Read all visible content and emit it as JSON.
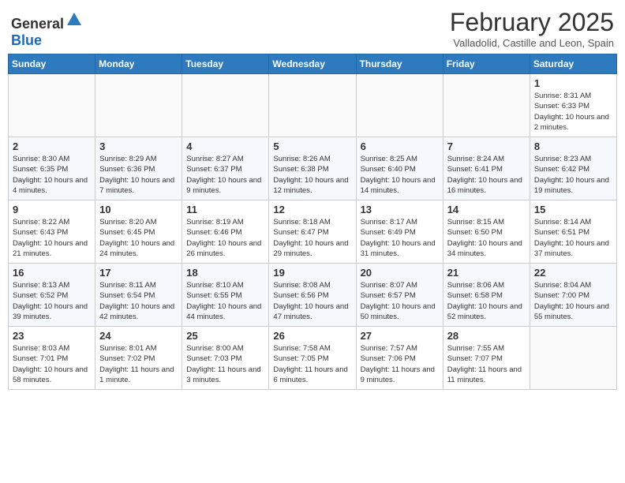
{
  "header": {
    "logo_general": "General",
    "logo_blue": "Blue",
    "month_year": "February 2025",
    "location": "Valladolid, Castille and Leon, Spain"
  },
  "weekdays": [
    "Sunday",
    "Monday",
    "Tuesday",
    "Wednesday",
    "Thursday",
    "Friday",
    "Saturday"
  ],
  "weeks": [
    [
      {
        "day": "",
        "info": ""
      },
      {
        "day": "",
        "info": ""
      },
      {
        "day": "",
        "info": ""
      },
      {
        "day": "",
        "info": ""
      },
      {
        "day": "",
        "info": ""
      },
      {
        "day": "",
        "info": ""
      },
      {
        "day": "1",
        "info": "Sunrise: 8:31 AM\nSunset: 6:33 PM\nDaylight: 10 hours and 2 minutes."
      }
    ],
    [
      {
        "day": "2",
        "info": "Sunrise: 8:30 AM\nSunset: 6:35 PM\nDaylight: 10 hours and 4 minutes."
      },
      {
        "day": "3",
        "info": "Sunrise: 8:29 AM\nSunset: 6:36 PM\nDaylight: 10 hours and 7 minutes."
      },
      {
        "day": "4",
        "info": "Sunrise: 8:27 AM\nSunset: 6:37 PM\nDaylight: 10 hours and 9 minutes."
      },
      {
        "day": "5",
        "info": "Sunrise: 8:26 AM\nSunset: 6:38 PM\nDaylight: 10 hours and 12 minutes."
      },
      {
        "day": "6",
        "info": "Sunrise: 8:25 AM\nSunset: 6:40 PM\nDaylight: 10 hours and 14 minutes."
      },
      {
        "day": "7",
        "info": "Sunrise: 8:24 AM\nSunset: 6:41 PM\nDaylight: 10 hours and 16 minutes."
      },
      {
        "day": "8",
        "info": "Sunrise: 8:23 AM\nSunset: 6:42 PM\nDaylight: 10 hours and 19 minutes."
      }
    ],
    [
      {
        "day": "9",
        "info": "Sunrise: 8:22 AM\nSunset: 6:43 PM\nDaylight: 10 hours and 21 minutes."
      },
      {
        "day": "10",
        "info": "Sunrise: 8:20 AM\nSunset: 6:45 PM\nDaylight: 10 hours and 24 minutes."
      },
      {
        "day": "11",
        "info": "Sunrise: 8:19 AM\nSunset: 6:46 PM\nDaylight: 10 hours and 26 minutes."
      },
      {
        "day": "12",
        "info": "Sunrise: 8:18 AM\nSunset: 6:47 PM\nDaylight: 10 hours and 29 minutes."
      },
      {
        "day": "13",
        "info": "Sunrise: 8:17 AM\nSunset: 6:49 PM\nDaylight: 10 hours and 31 minutes."
      },
      {
        "day": "14",
        "info": "Sunrise: 8:15 AM\nSunset: 6:50 PM\nDaylight: 10 hours and 34 minutes."
      },
      {
        "day": "15",
        "info": "Sunrise: 8:14 AM\nSunset: 6:51 PM\nDaylight: 10 hours and 37 minutes."
      }
    ],
    [
      {
        "day": "16",
        "info": "Sunrise: 8:13 AM\nSunset: 6:52 PM\nDaylight: 10 hours and 39 minutes."
      },
      {
        "day": "17",
        "info": "Sunrise: 8:11 AM\nSunset: 6:54 PM\nDaylight: 10 hours and 42 minutes."
      },
      {
        "day": "18",
        "info": "Sunrise: 8:10 AM\nSunset: 6:55 PM\nDaylight: 10 hours and 44 minutes."
      },
      {
        "day": "19",
        "info": "Sunrise: 8:08 AM\nSunset: 6:56 PM\nDaylight: 10 hours and 47 minutes."
      },
      {
        "day": "20",
        "info": "Sunrise: 8:07 AM\nSunset: 6:57 PM\nDaylight: 10 hours and 50 minutes."
      },
      {
        "day": "21",
        "info": "Sunrise: 8:06 AM\nSunset: 6:58 PM\nDaylight: 10 hours and 52 minutes."
      },
      {
        "day": "22",
        "info": "Sunrise: 8:04 AM\nSunset: 7:00 PM\nDaylight: 10 hours and 55 minutes."
      }
    ],
    [
      {
        "day": "23",
        "info": "Sunrise: 8:03 AM\nSunset: 7:01 PM\nDaylight: 10 hours and 58 minutes."
      },
      {
        "day": "24",
        "info": "Sunrise: 8:01 AM\nSunset: 7:02 PM\nDaylight: 11 hours and 1 minute."
      },
      {
        "day": "25",
        "info": "Sunrise: 8:00 AM\nSunset: 7:03 PM\nDaylight: 11 hours and 3 minutes."
      },
      {
        "day": "26",
        "info": "Sunrise: 7:58 AM\nSunset: 7:05 PM\nDaylight: 11 hours and 6 minutes."
      },
      {
        "day": "27",
        "info": "Sunrise: 7:57 AM\nSunset: 7:06 PM\nDaylight: 11 hours and 9 minutes."
      },
      {
        "day": "28",
        "info": "Sunrise: 7:55 AM\nSunset: 7:07 PM\nDaylight: 11 hours and 11 minutes."
      },
      {
        "day": "",
        "info": ""
      }
    ]
  ]
}
